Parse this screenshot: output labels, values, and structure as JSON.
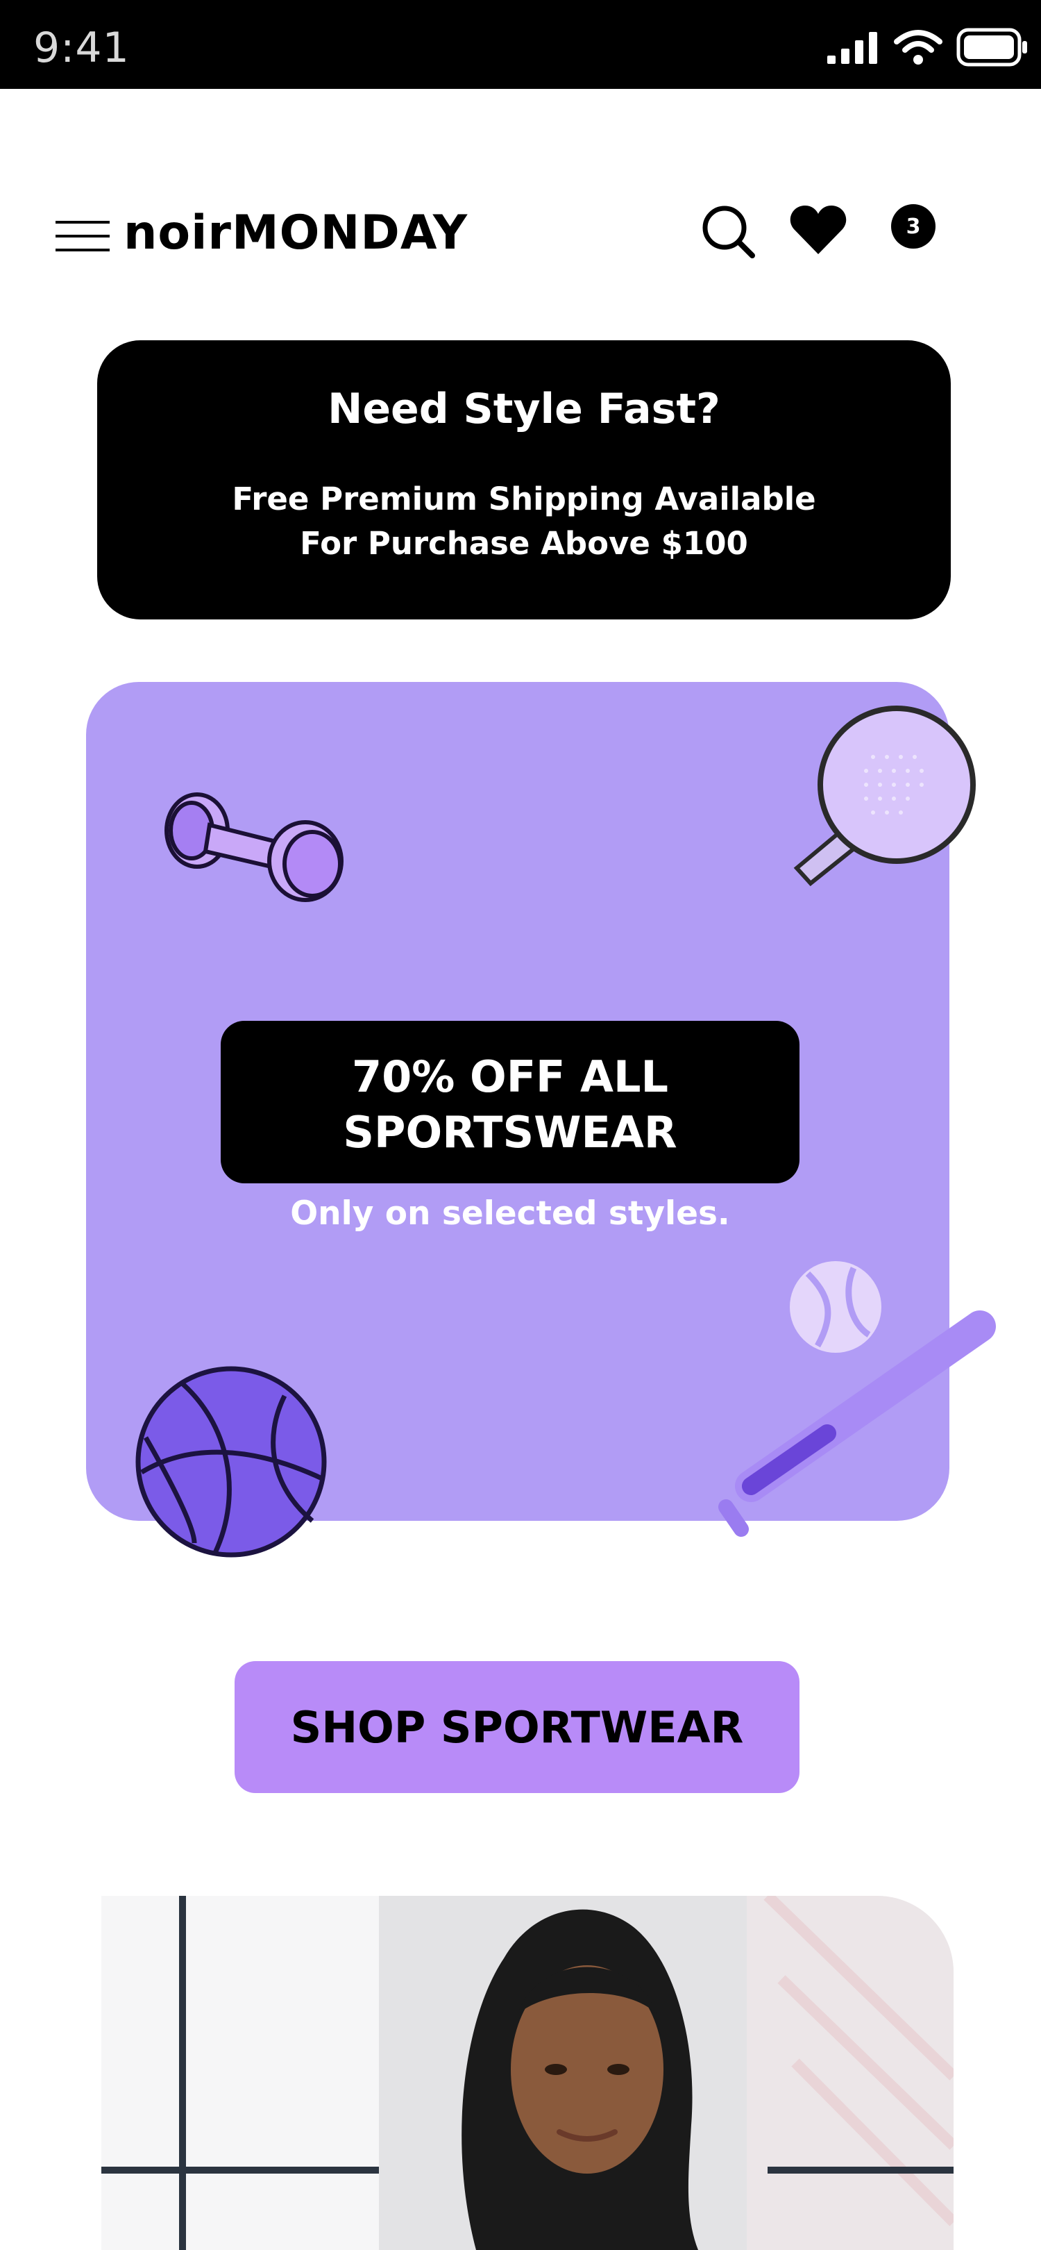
{
  "status_bar": {
    "time": "9:41"
  },
  "header": {
    "brand_light": "noir",
    "brand_bold": "MONDAY",
    "cart_count": "3"
  },
  "promo_banner": {
    "title": "Need Style Fast?",
    "line1": "Free Premium Shipping Available",
    "line2": "For Purchase Above $100"
  },
  "sale": {
    "line1": "70% OFF ALL",
    "line2": "SPORTSWEAR",
    "subtitle": "Only on selected styles."
  },
  "cta": {
    "label": "SHOP SPORTWEAR"
  },
  "icons": {
    "menu": "hamburger-menu-icon",
    "search": "search-icon",
    "wishlist": "heart-icon",
    "cart": "cart-badge-icon"
  },
  "colors": {
    "card_purple": "#b19cf5",
    "button_purple": "#b88bf8",
    "dark": "#000000"
  }
}
